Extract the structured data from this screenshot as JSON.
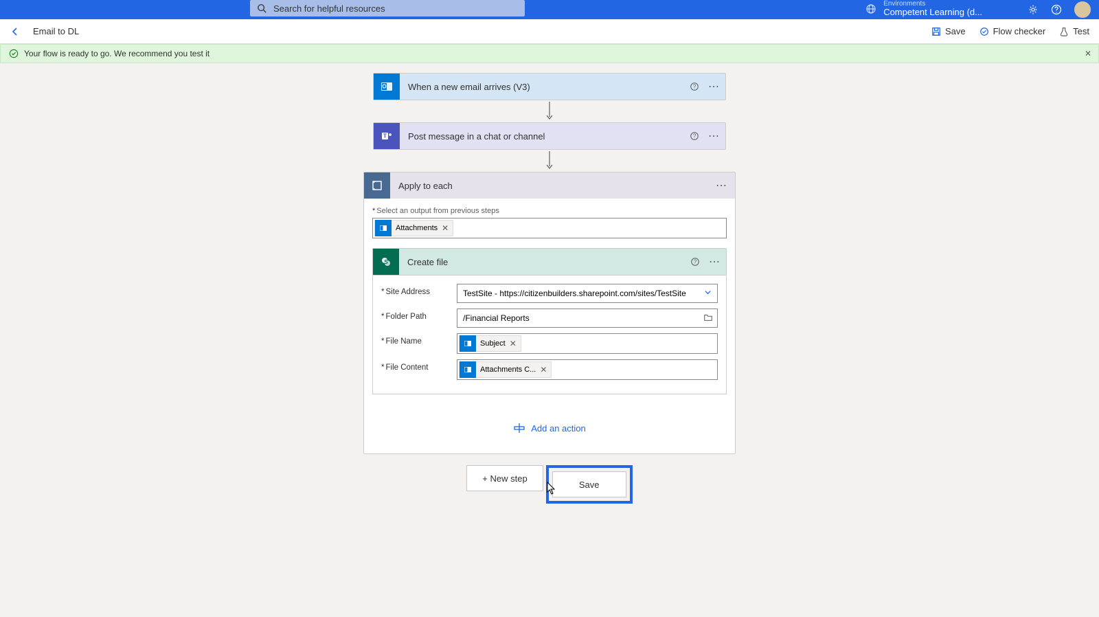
{
  "topbar": {
    "search_placeholder": "Search for helpful resources",
    "env_label": "Environments",
    "env_name": "Competent Learning (d..."
  },
  "flowbar": {
    "title": "Email to DL",
    "save": "Save",
    "flow_checker": "Flow checker",
    "test": "Test"
  },
  "notification": {
    "text": "Your flow is ready to go. We recommend you test it"
  },
  "steps": {
    "trigger_title": "When a new email arrives (V3)",
    "teams_title": "Post message in a chat or channel",
    "apply_title": "Apply to each",
    "apply_input_label": "Select an output from previous steps",
    "apply_token": "Attachments",
    "create_file_title": "Create file",
    "fields": {
      "site_label": "Site Address",
      "site_value": "TestSite - https://citizenbuilders.sharepoint.com/sites/TestSite",
      "folder_label": "Folder Path",
      "folder_value": "/Financial Reports",
      "filename_label": "File Name",
      "filename_token": "Subject",
      "content_label": "File Content",
      "content_token": "Attachments C..."
    },
    "add_action": "Add an action"
  },
  "footer": {
    "new_step": "+ New step",
    "save": "Save"
  }
}
